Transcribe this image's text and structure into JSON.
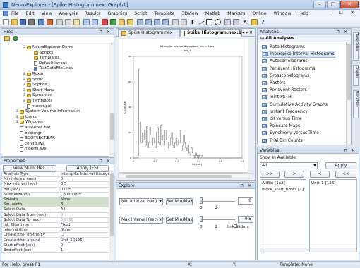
{
  "window": {
    "title": "NeuroExplorer - [Spike Histogram.nex: Graph1]",
    "min": "–",
    "max": "□",
    "close": "✕"
  },
  "menu": {
    "items": [
      "File",
      "Edit",
      "View",
      "Analysis",
      "Results",
      "Graphics",
      "Script",
      "Template",
      "3DView",
      "Matlab",
      "Markers",
      "Online",
      "Window",
      "Help"
    ],
    "mdi_controls": "– ☐ ✕"
  },
  "toolbar": {
    "text_tool": "T",
    "arrow_tool": "↖",
    "help_tool": "?"
  },
  "files_panel": {
    "title": "Files",
    "pin": "⊓ ✕",
    "tree": [
      {
        "label": "NeuroExplorer Demo",
        "type": "folder",
        "indent": 0,
        "exp": "⊟"
      },
      {
        "label": "Scripts",
        "type": "folder",
        "indent": 1,
        "exp": ""
      },
      {
        "label": "Templates",
        "type": "folder",
        "indent": 1,
        "exp": ""
      },
      {
        "label": "Default.layout",
        "type": "file",
        "indent": 1,
        "exp": ""
      },
      {
        "label": "TestDataFile1.nex",
        "type": "nex",
        "indent": 1,
        "exp": ""
      },
      {
        "label": "Roxio",
        "type": "folder",
        "indent": 0,
        "exp": "⊞"
      },
      {
        "label": "Sonic",
        "type": "folder",
        "indent": 0,
        "exp": "⊞"
      },
      {
        "label": "Sophos",
        "type": "folder",
        "indent": 0,
        "exp": "⊞"
      },
      {
        "label": "Start Menu",
        "type": "folder",
        "indent": 0,
        "exp": "⊞"
      },
      {
        "label": "Symantec",
        "type": "folder",
        "indent": 0,
        "exp": "⊞"
      },
      {
        "label": "Templates",
        "type": "folder",
        "indent": 0,
        "exp": "⊞"
      },
      {
        "label": "ntuser.pol",
        "type": "file",
        "indent": 0,
        "exp": ""
      },
      {
        "label": "System Volume Information",
        "type": "folder",
        "indent": -1,
        "exp": "⊞"
      },
      {
        "label": "Users",
        "type": "folder",
        "indent": -1,
        "exp": "⊞"
      },
      {
        "label": "Windows",
        "type": "folder",
        "indent": -1,
        "exp": "⊞"
      },
      {
        "label": "autoexec.bat",
        "type": "file",
        "indent": -1,
        "exp": ""
      },
      {
        "label": "bootmgr",
        "type": "file",
        "indent": -1,
        "exp": ""
      },
      {
        "label": "BOOTSECT.BAK",
        "type": "file",
        "indent": -1,
        "exp": ""
      },
      {
        "label": "config.sys",
        "type": "file",
        "indent": -1,
        "exp": ""
      },
      {
        "label": "hiberfil.sys",
        "type": "file",
        "indent": -1,
        "exp": ""
      }
    ]
  },
  "properties_panel": {
    "title": "Properties",
    "pin": "⊓ ✕",
    "header_left": "View Num. Res.",
    "header_right": "Apply (F5)",
    "rows": [
      {
        "k": "Analysis Type",
        "v": "Interspike Interval Histogra",
        "hl": false,
        "grey": false
      },
      {
        "k": "Min interval (sec)",
        "v": "0",
        "hl": false,
        "grey": false
      },
      {
        "k": "Max interval (sec)",
        "v": "0.5",
        "hl": false,
        "grey": false
      },
      {
        "k": "Bin (sec)",
        "v": "0.005",
        "hl": false,
        "grey": false
      },
      {
        "k": "Normalization",
        "v": "Counts/Bin",
        "hl": false,
        "grey": false
      },
      {
        "k": "Smooth",
        "v": "None",
        "hl": true,
        "grey": false
      },
      {
        "k": "Sm. width",
        "v": "3",
        "hl": true,
        "grey": false
      },
      {
        "k": "Select Data",
        "v": "All",
        "hl": false,
        "grey": false
      },
      {
        "k": "Select Data From (sec)",
        "v": "0",
        "hl": false,
        "grey": true
      },
      {
        "k": "Select Data To (sec)",
        "v": "5.9788",
        "hl": false,
        "grey": true
      },
      {
        "k": "Int. filter type",
        "v": "Fixed",
        "hl": false,
        "grey": false
      },
      {
        "k": "Interval filter",
        "v": "None",
        "hl": false,
        "grey": false
      },
      {
        "k": "Create filter on-the-fly",
        "v": "☐",
        "hl": false,
        "grey": false
      },
      {
        "k": "Create filter around",
        "v": "Unit_1 [126]",
        "hl": false,
        "grey": false
      },
      {
        "k": "Start offset (sec)",
        "v": "0",
        "hl": false,
        "grey": false
      },
      {
        "k": "End offset (sec)",
        "v": "1",
        "hl": false,
        "grey": false
      }
    ]
  },
  "tabs": [
    {
      "label": "Spike Histogram.nex",
      "active": false
    },
    {
      "label": "Spike Histogram.nex:1",
      "active": true
    }
  ],
  "tab_controls": "◂ ▸ ✕",
  "graph": {
    "title": "Interspike Interval Histograms, bin = 5 ms",
    "subtitle": "Unit_1",
    "ylabel": "Counts/Bin",
    "xlabel": "Int. (sec)",
    "yticks": [
      "80",
      "60",
      "40",
      "20",
      "0"
    ],
    "xticks": [
      "0",
      "0.1",
      "0.2",
      "0.3",
      "0.4",
      "0.5"
    ]
  },
  "chart_data": {
    "type": "bar",
    "title": "Interspike Interval Histograms, bin = 5 ms",
    "subtitle": "Unit_1",
    "xlabel": "Int. (sec)",
    "ylabel": "Counts/Bin",
    "xlim": [
      0,
      0.5
    ],
    "ylim": [
      0,
      80
    ],
    "bin_width": 0.005,
    "x": [
      0.0,
      0.005,
      0.01,
      0.015,
      0.02,
      0.025,
      0.03,
      0.035,
      0.04,
      0.045,
      0.05,
      0.055,
      0.06,
      0.065,
      0.07,
      0.075,
      0.08,
      0.085,
      0.09,
      0.095,
      0.1,
      0.105,
      0.11,
      0.115,
      0.12,
      0.125,
      0.13,
      0.135,
      0.14,
      0.145,
      0.15,
      0.155,
      0.16,
      0.165,
      0.17,
      0.175,
      0.18,
      0.185,
      0.19,
      0.195,
      0.2,
      0.205,
      0.21,
      0.215,
      0.22,
      0.225,
      0.23,
      0.235,
      0.24,
      0.245,
      0.25,
      0.255,
      0.26,
      0.265,
      0.27,
      0.275,
      0.28,
      0.285,
      0.29,
      0.295,
      0.3,
      0.305,
      0.31,
      0.315,
      0.32,
      0.325,
      0.33,
      0.335,
      0.34,
      0.345,
      0.35,
      0.355,
      0.36,
      0.365,
      0.37,
      0.375,
      0.38,
      0.385,
      0.39,
      0.395,
      0.4,
      0.405,
      0.41,
      0.415,
      0.42,
      0.425,
      0.43,
      0.435,
      0.44,
      0.445,
      0.45,
      0.455,
      0.46,
      0.465,
      0.47,
      0.475,
      0.48,
      0.485,
      0.49,
      0.495
    ],
    "values": [
      0,
      0,
      0,
      0,
      2,
      70,
      28,
      12,
      20,
      14,
      22,
      10,
      25,
      8,
      12,
      24,
      18,
      10,
      16,
      12,
      8,
      20,
      24,
      12,
      10,
      26,
      14,
      18,
      10,
      22,
      14,
      8,
      12,
      10,
      16,
      20,
      10,
      8,
      12,
      16,
      10,
      14,
      22,
      12,
      6,
      10,
      18,
      12,
      8,
      6,
      10,
      4,
      2,
      8,
      4,
      2,
      0,
      4,
      2,
      0,
      2,
      0,
      0,
      2,
      0,
      0,
      0,
      0,
      0,
      0,
      0,
      0,
      0,
      0,
      0,
      0,
      0,
      0,
      0,
      0,
      0,
      0,
      0,
      0,
      0,
      0,
      0,
      0,
      0,
      0,
      0,
      0,
      0,
      0,
      0,
      0,
      0,
      0,
      0,
      0
    ]
  },
  "explore": {
    "title": "Explore",
    "pin": "⊓ ✕",
    "row1": {
      "combo": "Min interval (sec)",
      "btn": "Set Min/Max",
      "left": "0",
      "right": "2",
      "value": "0"
    },
    "row2": {
      "combo": "Max interval (sec)",
      "btn": "Set Min/Max",
      "left": "0",
      "right": "2",
      "value": "0.5",
      "link": "link Sliders"
    }
  },
  "analyses": {
    "title": "Analyses",
    "pin": "⊓ ✕",
    "header": "All Analyses",
    "items": [
      "Rate Histograms",
      "Interspike Interval Histograms",
      "Autocorrelograms",
      "Perievent Histograms",
      "Crosscorrelograms",
      "Rasters",
      "Perievent Rasters",
      "Joint PSTH",
      "Cumulative Activity Graphs",
      "Instant Frequency",
      "ISI versus Time",
      "Poincare Maps",
      "Synchrony versus Time",
      "Trial Bin Counts"
    ],
    "selected": 1
  },
  "variables": {
    "title": "Variables",
    "pin": "⊓ ✕",
    "show_label": "Show in Available:",
    "filter": "All",
    "apply": "Apply",
    "move_buttons": [
      ">>",
      ">",
      "<",
      "<<"
    ],
    "available": [
      "AllFile [1x2]",
      "Block_start_times [1]"
    ],
    "selected": [
      "Unit_1 [126]"
    ]
  },
  "side_tabs": [
    "Templates",
    "Graphs",
    "Variables"
  ],
  "status": {
    "help": "For Help, press F1",
    "x": "X:",
    "y": "Y:",
    "template": "Template: None"
  }
}
